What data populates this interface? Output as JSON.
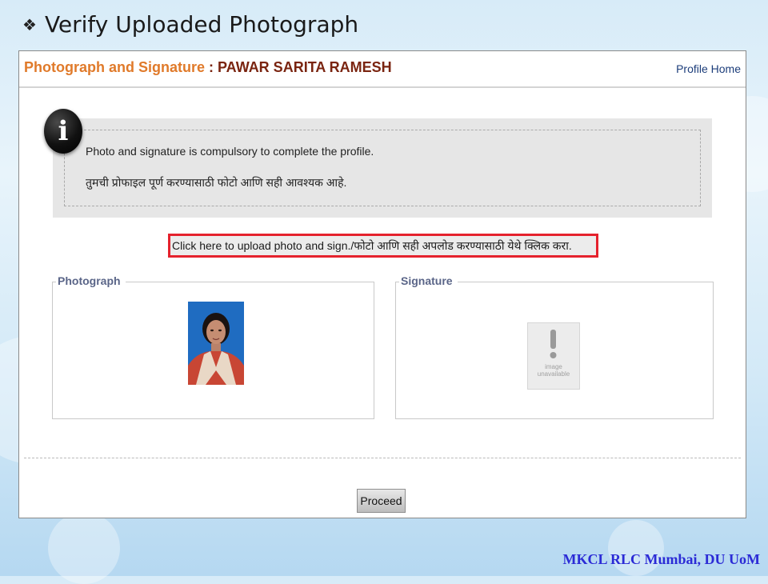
{
  "slide": {
    "title": "Verify Uploaded Photograph",
    "bullet_icon": "diamond-bullet-icon",
    "footer": "MKCL RLC Mumbai, DU UoM"
  },
  "page": {
    "header_label": "Photograph and Signature",
    "header_separator": " : ",
    "student_name": "PAWAR SARITA RAMESH",
    "profile_home_link": "Profile Home"
  },
  "info": {
    "icon": "info-icon",
    "icon_glyph": "i",
    "line_en": "Photo and signature is compulsory to complete the profile.",
    "line_mr": "तुमची प्रोफाइल पूर्ण करण्यासाठी फोटो आणि सही आवश्यक आहे."
  },
  "upload": {
    "link_text": "Click here to upload photo and sign./फोटो आणि सही अपलोड करण्यासाठी येथे क्लिक करा."
  },
  "photo_section": {
    "legend": "Photograph"
  },
  "signature_section": {
    "legend": "Signature",
    "placeholder_line1": "image",
    "placeholder_line2": "unavailable"
  },
  "actions": {
    "proceed_label": "Proceed"
  },
  "colors": {
    "header_label": "#e07a2a",
    "header_name": "#7a2410",
    "upload_border": "#e5222d",
    "footer_text": "#2b2bd6"
  }
}
